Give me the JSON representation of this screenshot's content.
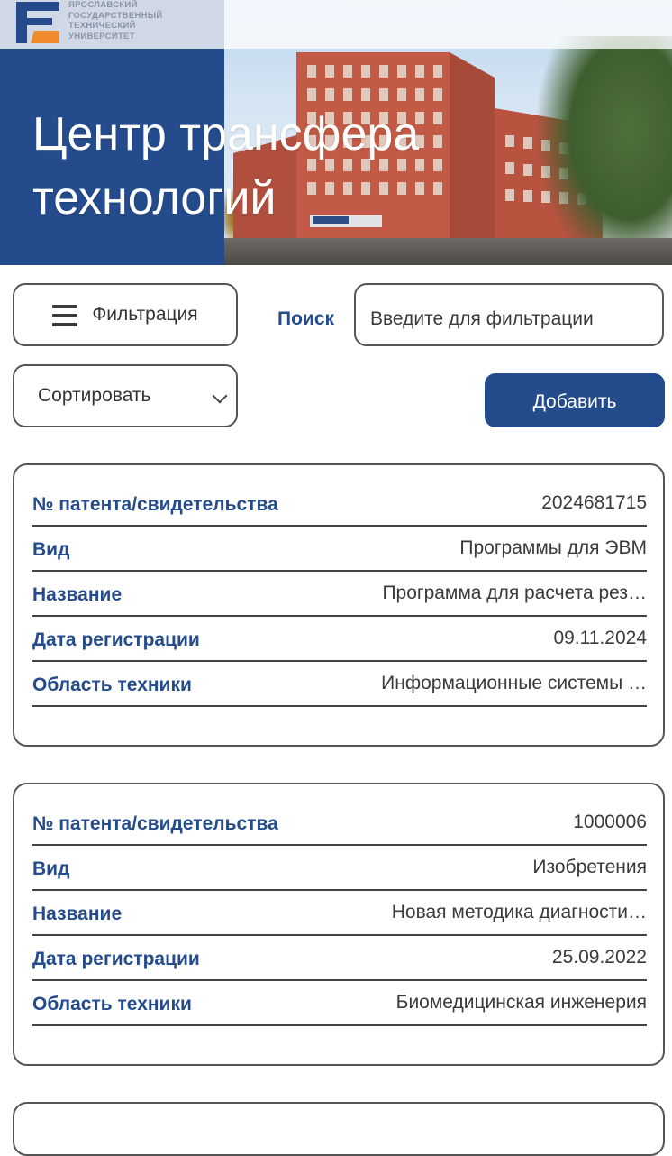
{
  "header": {
    "university_lines": [
      "ЯРОСЛАВСКИЙ",
      "ГОСУДАРСТВЕННЫЙ",
      "ТЕХНИЧЕСКИЙ",
      "УНИВЕРСИТЕТ"
    ],
    "title_line1": "Центр трансфера",
    "title_line2": "технологий",
    "colors": {
      "brand_blue": "#244b8c",
      "logo_orange": "#f08a2c"
    }
  },
  "controls": {
    "filter_label": "Фильтрация",
    "search_label": "Поиск",
    "search_placeholder": "Введите для фильтрации",
    "search_value": "",
    "sort_label": "Сортировать",
    "add_label": "Добавить"
  },
  "icons": [
    "menu-icon",
    "chevron-down-icon",
    "university-logo-icon"
  ],
  "records": [
    {
      "patent_label": "№ патента/свидетельства",
      "patent_value": "2024681715",
      "type_label": "Вид",
      "type_value": "Программы для ЭВМ",
      "name_label": "Название",
      "name_value": "Программа для расчета рез…",
      "date_label": "Дата регистрации",
      "date_value": "09.11.2024",
      "field_label": "Область техники",
      "field_value": "Информационные системы …"
    },
    {
      "patent_label": "№ патента/свидетельства",
      "patent_value": "1000006",
      "type_label": "Вид",
      "type_value": "Изобретения",
      "name_label": "Название",
      "name_value": "Новая методика диагности…",
      "date_label": "Дата регистрации",
      "date_value": "25.09.2022",
      "field_label": "Область техники",
      "field_value": "Биомедицинская инженерия"
    }
  ]
}
